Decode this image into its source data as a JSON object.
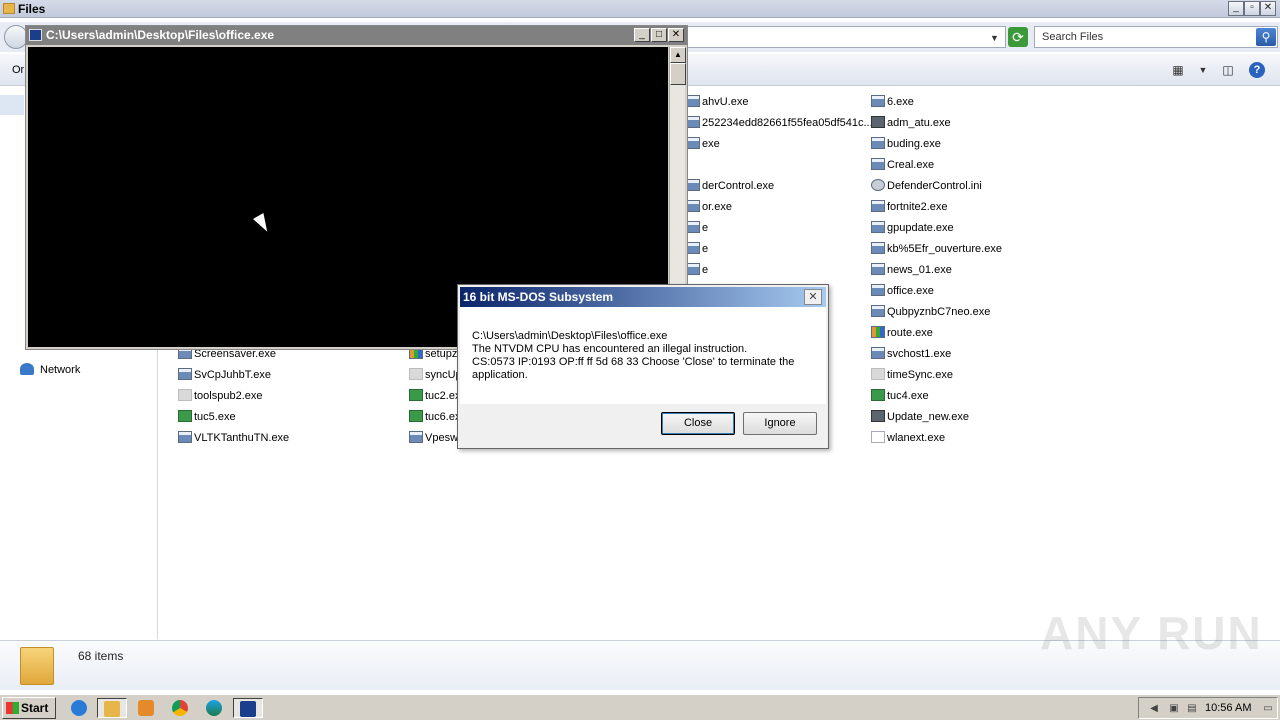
{
  "explorer": {
    "title": "Files",
    "organize_label": "Or",
    "search_placeholder": "Search Files",
    "nav_network": "Network",
    "status_count": "68 items"
  },
  "files": [
    {
      "name": "ahvU.exe",
      "icon": "exe-icon",
      "col": 3,
      "row": 0
    },
    {
      "name": "252234edd82661f55fea05df541c...",
      "icon": "exe-icon",
      "col": 3,
      "row": 1
    },
    {
      "name": "exe",
      "icon": "exe-icon",
      "col": 3,
      "row": 2
    },
    {
      "name": "derControl.exe",
      "icon": "exe-icon",
      "col": 3,
      "row": 4
    },
    {
      "name": "or.exe",
      "icon": "exe-icon",
      "col": 3,
      "row": 5
    },
    {
      "name": "e",
      "icon": "exe-icon",
      "col": 3,
      "row": 6
    },
    {
      "name": "e",
      "icon": "exe-icon",
      "col": 3,
      "row": 7
    },
    {
      "name": "e",
      "icon": "exe-icon",
      "col": 3,
      "row": 8
    },
    {
      "name": "6.exe",
      "icon": "exe-icon",
      "col": 4,
      "row": 0
    },
    {
      "name": "adm_atu.exe",
      "icon": "box-icon",
      "col": 4,
      "row": 1
    },
    {
      "name": "buding.exe",
      "icon": "exe-icon",
      "col": 4,
      "row": 2
    },
    {
      "name": "Creal.exe",
      "icon": "exe-icon",
      "col": 4,
      "row": 3
    },
    {
      "name": "DefenderControl.ini",
      "icon": "settings-file-icon",
      "col": 4,
      "row": 4
    },
    {
      "name": "fortnite2.exe",
      "icon": "exe-icon",
      "col": 4,
      "row": 5
    },
    {
      "name": "gpupdate.exe",
      "icon": "exe-icon",
      "col": 4,
      "row": 6
    },
    {
      "name": "kb%5Efr_ouverture.exe",
      "icon": "exe-icon",
      "col": 4,
      "row": 7
    },
    {
      "name": "news_01.exe",
      "icon": "exe-icon",
      "col": 4,
      "row": 8
    },
    {
      "name": "office.exe",
      "icon": "exe-icon",
      "col": 4,
      "row": 9
    },
    {
      "name": "QubpyznbC7neo.exe",
      "icon": "exe-icon",
      "col": 4,
      "row": 10
    },
    {
      "name": "route.exe",
      "icon": "color-icon",
      "col": 4,
      "row": 11
    },
    {
      "name": "svchost1.exe",
      "icon": "exe-icon",
      "col": 4,
      "row": 12
    },
    {
      "name": "timeSync.exe",
      "icon": "plain-icon",
      "col": 4,
      "row": 13
    },
    {
      "name": "tuc4.exe",
      "icon": "installer-icon",
      "col": 4,
      "row": 14
    },
    {
      "name": "Update_new.exe",
      "icon": "box-icon",
      "col": 4,
      "row": 15
    },
    {
      "name": "wlanext.exe",
      "icon": "doc-icon",
      "col": 4,
      "row": 16
    },
    {
      "name": "Screensaver.exe",
      "icon": "exe-icon",
      "col": 1,
      "row": 12
    },
    {
      "name": "SvCpJuhbT.exe",
      "icon": "exe-icon",
      "col": 1,
      "row": 13
    },
    {
      "name": "toolspub2.exe",
      "icon": "plain-icon",
      "col": 1,
      "row": 14
    },
    {
      "name": "tuc5.exe",
      "icon": "installer-icon",
      "col": 1,
      "row": 15
    },
    {
      "name": "VLTKTanthuTN.exe",
      "icon": "exe-icon",
      "col": 1,
      "row": 16
    },
    {
      "name": "setupz",
      "icon": "color-icon",
      "col": 2,
      "row": 12
    },
    {
      "name": "syncUp",
      "icon": "plain-icon",
      "col": 2,
      "row": 13
    },
    {
      "name": "tuc2.ex",
      "icon": "installer-icon",
      "col": 2,
      "row": 14
    },
    {
      "name": "tuc6.ex",
      "icon": "installer-icon",
      "col": 2,
      "row": 15
    },
    {
      "name": "Vpesw",
      "icon": "exe-icon",
      "col": 2,
      "row": 16
    }
  ],
  "dos_window": {
    "title": "C:\\Users\\admin\\Desktop\\Files\\office.exe"
  },
  "dialog": {
    "title": "16 bit MS-DOS Subsystem",
    "line1": "C:\\Users\\admin\\Desktop\\Files\\office.exe",
    "line2": "The NTVDM CPU has encountered an illegal instruction.",
    "line3": "CS:0573 IP:0193 OP:ff ff 5d 68 33 Choose 'Close' to terminate the application.",
    "close_label": "Close",
    "ignore_label": "Ignore"
  },
  "taskbar": {
    "start_label": "Start",
    "clock": "10:56 AM"
  },
  "watermark": "ANY RUN"
}
